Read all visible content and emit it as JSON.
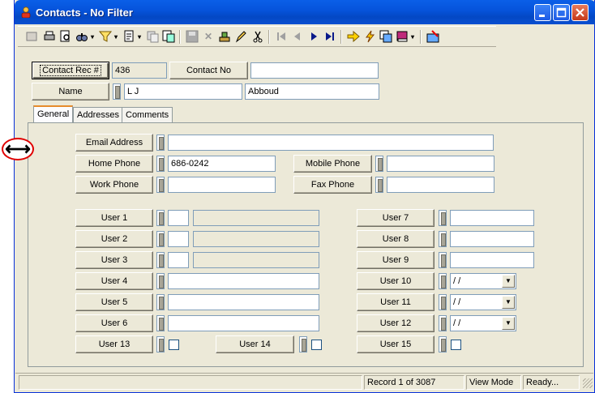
{
  "window": {
    "title": "Contacts - No Filter"
  },
  "toolbar": {
    "icons": [
      "new-record-icon",
      "print-icon",
      "print-preview-icon",
      "find-icon",
      "dropdown-arrow-icon",
      "filter-icon",
      "dropdown-arrow-icon",
      "report-icon",
      "dropdown-arrow-icon",
      "copy-form-icon",
      "paste-form-icon",
      "save-icon",
      "delete-icon",
      "stamp-icon",
      "edit-icon",
      "cut-icon",
      "first-record-icon",
      "previous-record-icon",
      "next-record-icon",
      "last-record-icon",
      "goto-icon",
      "lightning-icon",
      "window-icon",
      "book-icon",
      "dropdown-arrow-icon",
      "close-form-icon"
    ]
  },
  "header": {
    "contact_rec_label": "Contact Rec #",
    "contact_rec_value": "436",
    "contact_no_label": "Contact No",
    "contact_no_value": "",
    "name_label": "Name",
    "first_name": "L J",
    "last_name": "Abboud"
  },
  "tabs": [
    "General",
    "Addresses",
    "Comments"
  ],
  "general": {
    "email_label": "Email Address",
    "email_value": "",
    "home_phone_label": "Home Phone",
    "home_phone_value": "686-0242",
    "mobile_phone_label": "Mobile Phone",
    "mobile_phone_value": "",
    "work_phone_label": "Work Phone",
    "work_phone_value": "",
    "fax_phone_label": "Fax Phone",
    "fax_phone_value": "",
    "user1": "User 1",
    "user2": "User 2",
    "user3": "User 3",
    "user4": "User 4",
    "user5": "User 5",
    "user6": "User 6",
    "user7": "User 7",
    "user8": "User 8",
    "user9": "User 9",
    "user10": "User 10",
    "user11": "User 11",
    "user12": "User 12",
    "user13": "User 13",
    "user14": "User 14",
    "user15": "User 15",
    "date_value": " / /"
  },
  "status": {
    "record": "Record 1 of 3087",
    "mode": "View Mode",
    "state": "Ready..."
  },
  "colors": {
    "title_bar": "#0654dc",
    "face": "#ece9d8",
    "tab_highlight": "#e68b2c",
    "annotation": "#e00000"
  }
}
